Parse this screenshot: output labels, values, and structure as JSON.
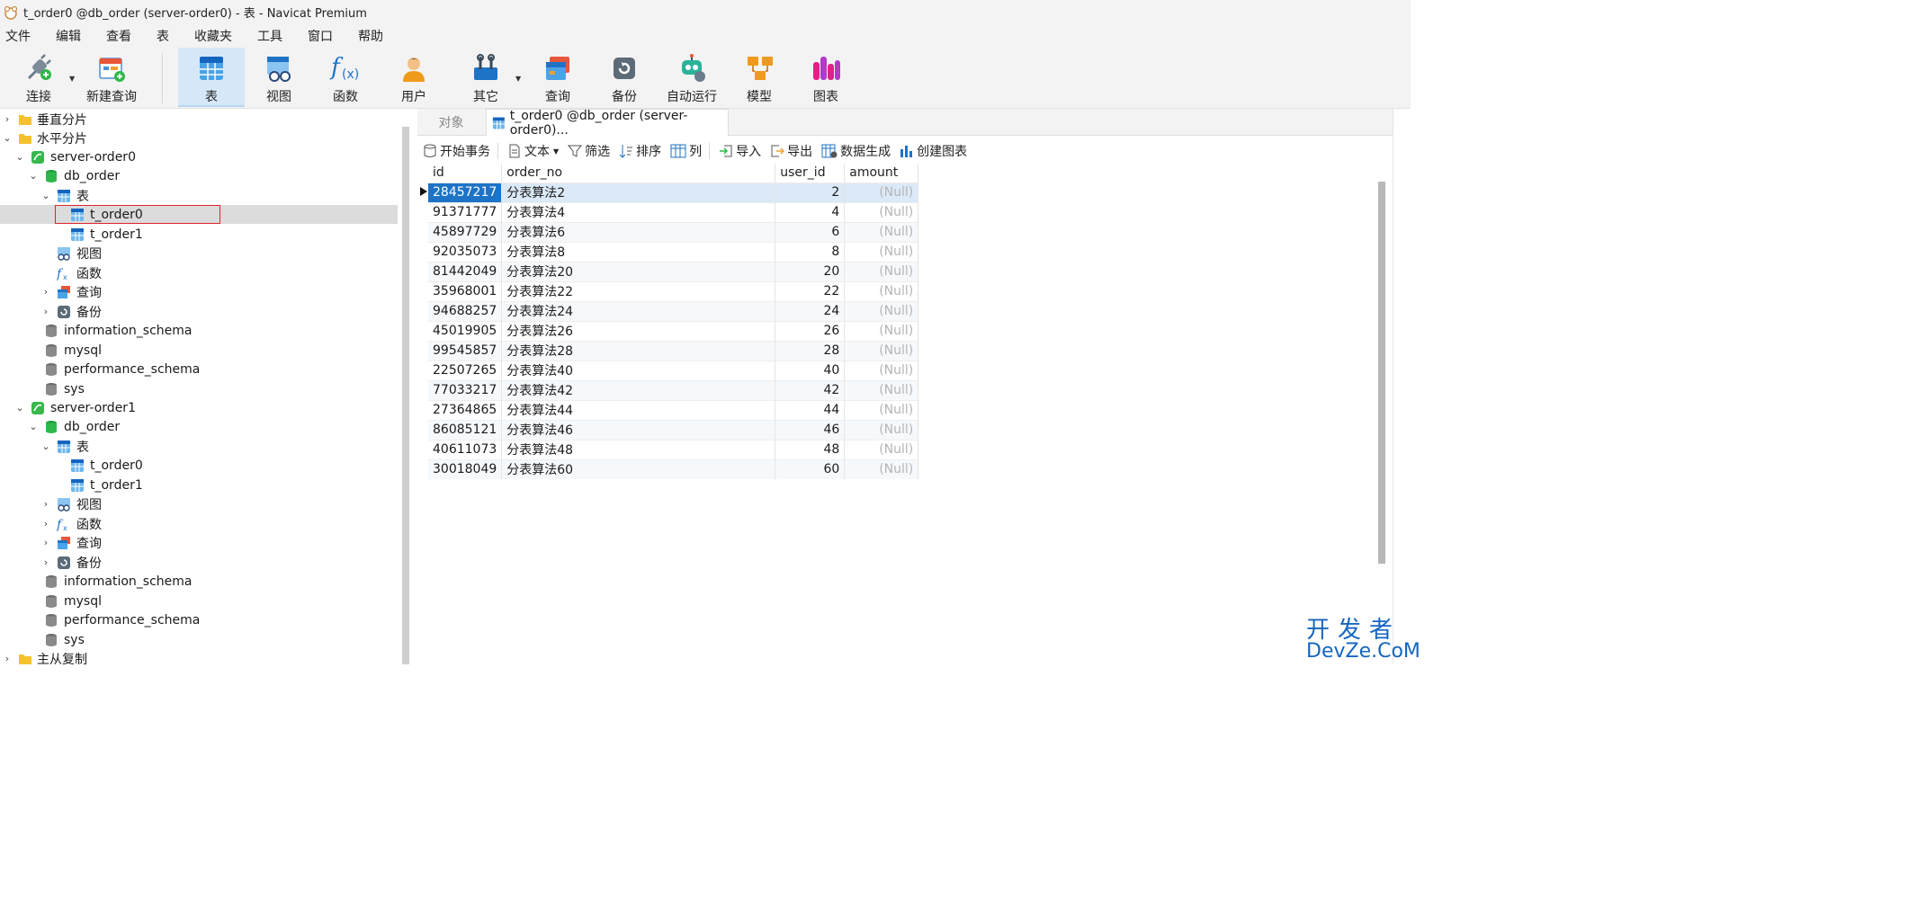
{
  "window": {
    "title": "t_order0 @db_order (server-order0) - 表 - Navicat Premium"
  },
  "menu": [
    "文件",
    "编辑",
    "查看",
    "表",
    "收藏夹",
    "工具",
    "窗口",
    "帮助"
  ],
  "toolbar": {
    "connect": "连接",
    "new_query": "新建查询",
    "table": "表",
    "view": "视图",
    "function": "函数",
    "user": "用户",
    "other": "其它",
    "query": "查询",
    "backup": "备份",
    "auto_run": "自动运行",
    "model": "模型",
    "chart": "图表"
  },
  "tree": [
    {
      "label": "垂直分片",
      "type": "folder",
      "expanded": false
    },
    {
      "label": "水平分片",
      "type": "folder",
      "expanded": true
    },
    {
      "label": "server-order0",
      "type": "server",
      "expanded": true
    },
    {
      "label": "db_order",
      "type": "database-active",
      "expanded": true
    },
    {
      "label": "表",
      "type": "tables",
      "expanded": true
    },
    {
      "label": "t_order0",
      "type": "table",
      "selected": true
    },
    {
      "label": "t_order1",
      "type": "table"
    },
    {
      "label": "视图",
      "type": "views"
    },
    {
      "label": "函数",
      "type": "functions"
    },
    {
      "label": "查询",
      "type": "queries",
      "expanded": false
    },
    {
      "label": "备份",
      "type": "backups",
      "expanded": false
    },
    {
      "label": "information_schema",
      "type": "database"
    },
    {
      "label": "mysql",
      "type": "database"
    },
    {
      "label": "performance_schema",
      "type": "database"
    },
    {
      "label": "sys",
      "type": "database"
    },
    {
      "label": "server-order1",
      "type": "server",
      "expanded": true
    },
    {
      "label": "db_order",
      "type": "database-active",
      "expanded": true
    },
    {
      "label": "表",
      "type": "tables",
      "expanded": true
    },
    {
      "label": "t_order0",
      "type": "table"
    },
    {
      "label": "t_order1",
      "type": "table"
    },
    {
      "label": "视图",
      "type": "views",
      "expanded": false
    },
    {
      "label": "函数",
      "type": "functions",
      "expanded": false
    },
    {
      "label": "查询",
      "type": "queries",
      "expanded": false
    },
    {
      "label": "备份",
      "type": "backups",
      "expanded": false
    },
    {
      "label": "information_schema",
      "type": "database"
    },
    {
      "label": "mysql",
      "type": "database"
    },
    {
      "label": "performance_schema",
      "type": "database"
    },
    {
      "label": "sys",
      "type": "database"
    },
    {
      "label": "主从复制",
      "type": "folder",
      "expanded": false
    }
  ],
  "tabs": {
    "objects": "对象",
    "active": "t_order0 @db_order (server-order0)..."
  },
  "subtoolbar": {
    "begin_tx": "开始事务",
    "text": "文本",
    "filter": "筛选",
    "sort": "排序",
    "columns": "列",
    "import": "导入",
    "export": "导出",
    "generate": "数据生成",
    "create_chart": "创建图表"
  },
  "grid": {
    "columns": [
      "id",
      "order_no",
      "user_id",
      "amount"
    ],
    "rows": [
      [
        "28457217",
        "分表算法2",
        "2",
        "(Null)"
      ],
      [
        "91371777",
        "分表算法4",
        "4",
        "(Null)"
      ],
      [
        "45897729",
        "分表算法6",
        "6",
        "(Null)"
      ],
      [
        "92035073",
        "分表算法8",
        "8",
        "(Null)"
      ],
      [
        "81442049",
        "分表算法20",
        "20",
        "(Null)"
      ],
      [
        "35968001",
        "分表算法22",
        "22",
        "(Null)"
      ],
      [
        "94688257",
        "分表算法24",
        "24",
        "(Null)"
      ],
      [
        "45019905",
        "分表算法26",
        "26",
        "(Null)"
      ],
      [
        "99545857",
        "分表算法28",
        "28",
        "(Null)"
      ],
      [
        "22507265",
        "分表算法40",
        "40",
        "(Null)"
      ],
      [
        "77033217",
        "分表算法42",
        "42",
        "(Null)"
      ],
      [
        "27364865",
        "分表算法44",
        "44",
        "(Null)"
      ],
      [
        "86085121",
        "分表算法46",
        "46",
        "(Null)"
      ],
      [
        "40611073",
        "分表算法48",
        "48",
        "(Null)"
      ],
      [
        "30018049",
        "分表算法60",
        "60",
        "(Null)"
      ]
    ]
  },
  "watermark": {
    "line1": "开发者",
    "line2": "DevZe.CoM"
  }
}
